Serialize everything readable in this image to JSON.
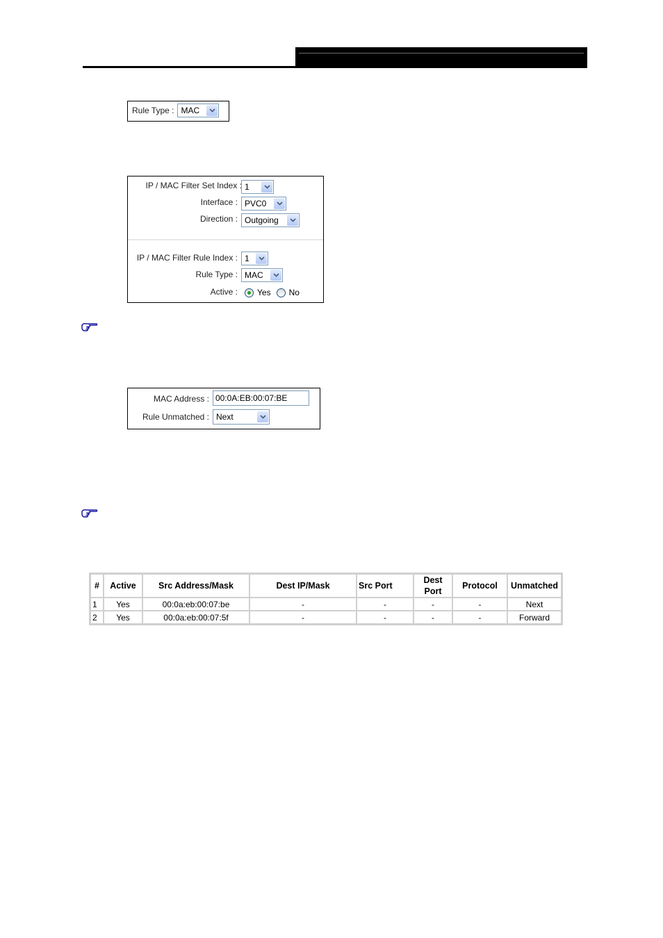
{
  "header": {},
  "rule_type_box": {
    "label": "Rule Type :",
    "value": "MAC"
  },
  "filter_box": {
    "set_index_label": "IP / MAC Filter Set Index :",
    "set_index_value": "1",
    "interface_label": "Interface :",
    "interface_value": "PVC0",
    "direction_label": "Direction :",
    "direction_value": "Outgoing",
    "rule_index_label": "IP / MAC Filter Rule Index :",
    "rule_index_value": "1",
    "rule_type_label": "Rule Type :",
    "rule_type_value": "MAC",
    "active_label": "Active :",
    "active_options": [
      "Yes",
      "No"
    ],
    "active_selected": "Yes"
  },
  "mac_box": {
    "mac_label": "MAC Address :",
    "mac_value": "00:0A:EB:00:07:BE",
    "unmatched_label": "Rule Unmatched :",
    "unmatched_value": "Next"
  },
  "icons": {
    "note_pointer_1": "pointing-hand-icon",
    "note_pointer_2": "pointing-hand-icon",
    "pointer_color": "#1a1aa0"
  },
  "rules_table": {
    "columns": [
      "#",
      "Active",
      "Src Address/Mask",
      "Dest IP/Mask",
      "Src Port",
      "Dest Port",
      "Protocol",
      "Unmatched"
    ],
    "rows": [
      [
        "1",
        "Yes",
        "00:0a:eb:00:07:be",
        "-",
        "-",
        "-",
        "-",
        "Next"
      ],
      [
        "2",
        "Yes",
        "00:0a:eb:00:07:5f",
        "-",
        "-",
        "-",
        "-",
        "Forward"
      ]
    ]
  }
}
